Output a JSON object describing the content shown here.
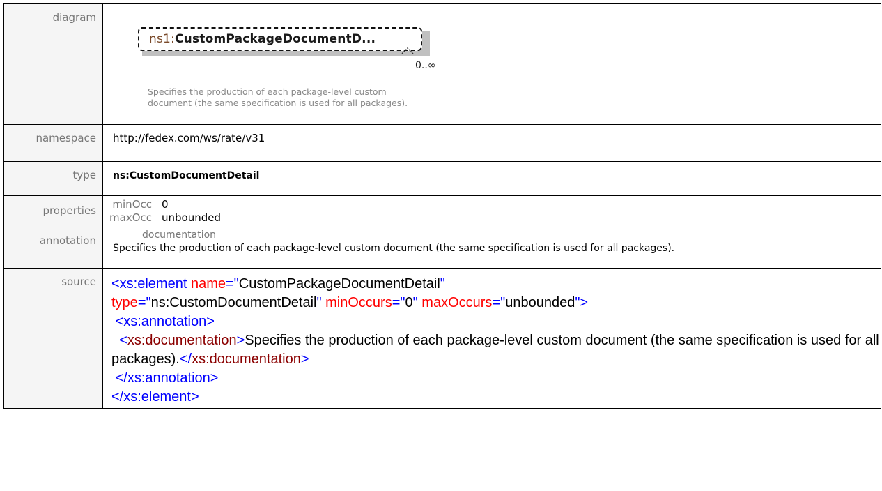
{
  "labels": {
    "diagram": "diagram",
    "namespace": "namespace",
    "type": "type",
    "properties": "properties",
    "annotation": "annotation",
    "source": "source"
  },
  "diagram": {
    "prefix": "ns1:",
    "name": "CustomPackageDocumentD...",
    "occurrence": "0..∞",
    "doc": "Specifies the production of each package-level custom document (the same specification is used for all packages)."
  },
  "namespace": "http://fedex.com/ws/rate/v31",
  "type": "ns:CustomDocumentDetail",
  "properties": [
    {
      "key": "minOcc",
      "value": "0"
    },
    {
      "key": "maxOcc",
      "value": "unbounded"
    }
  ],
  "annotation": {
    "label": "documentation",
    "text": "Specifies the production of each package-level custom document (the same specification is used for all packages)."
  },
  "source": {
    "open_tag": "<xs:element",
    "name_attr": "name",
    "name_val": "CustomPackageDocumentDetail",
    "type_attr": "type",
    "type_val": "ns:CustomDocumentDetail",
    "min_attr": "minOccurs",
    "min_val": "0",
    "max_attr": "maxOccurs",
    "max_val": "unbounded",
    "ann_open": "xs:annotation",
    "doc_open": "xs:documentation",
    "doc_text": "Specifies the production of each package-level custom document (the same specification is used for all packages).",
    "doc_close": "xs:documentation",
    "ann_close": "xs:annotation",
    "el_close": "xs:element"
  }
}
